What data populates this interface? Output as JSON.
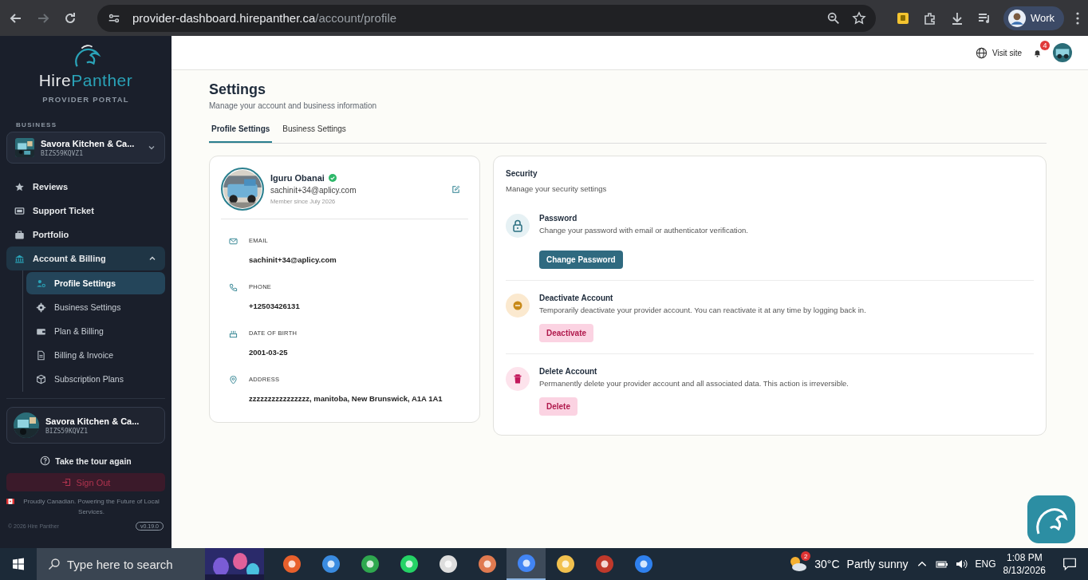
{
  "browser": {
    "url_host": "provider-dashboard.hirepanther.ca",
    "url_path": "/account/profile",
    "profile_label": "Work"
  },
  "sidebar": {
    "brand_first": "Hire",
    "brand_second": "Panther",
    "subtitle": "PROVIDER PORTAL",
    "section_label": "BUSINESS",
    "business": {
      "name": "Savora Kitchen & Ca...",
      "id": "BIZS59KQVZ1"
    },
    "nav": [
      {
        "label": "Reviews",
        "kind": "star",
        "selected": false
      },
      {
        "label": "Support Ticket",
        "kind": "ticket",
        "selected": false
      },
      {
        "label": "Portfolio",
        "kind": "briefcase",
        "selected": false
      },
      {
        "label": "Account & Billing",
        "kind": "bank",
        "selected": false,
        "expanded": true,
        "children": [
          {
            "label": "Profile Settings",
            "kind": "user-gear",
            "selected": true
          },
          {
            "label": "Business Settings",
            "kind": "gear",
            "selected": false
          },
          {
            "label": "Plan & Billing",
            "kind": "wallet",
            "selected": false
          },
          {
            "label": "Billing & Invoice",
            "kind": "document",
            "selected": false
          },
          {
            "label": "Subscription Plans",
            "kind": "box",
            "selected": false
          }
        ]
      }
    ],
    "footer_business": {
      "name": "Savora Kitchen & Ca...",
      "id": "BIZS59KQVZ1"
    },
    "tour": "Take the tour again",
    "sign_out": "Sign Out",
    "tagline": "Proudly Canadian. Powering the Future of Local Services.",
    "copyright": "© 2026 Hire Panther",
    "version": "v0.19.0"
  },
  "header": {
    "visit_site": "Visit site",
    "notification_count": "4"
  },
  "page": {
    "title": "Settings",
    "subtitle": "Manage your account and business information",
    "tabs": [
      {
        "label": "Profile Settings",
        "selected": true
      },
      {
        "label": "Business Settings",
        "selected": false
      }
    ]
  },
  "profile": {
    "name": "Iguru Obanai",
    "verified": true,
    "email": "sachinit+34@aplicy.com",
    "member_since": "Member since July 2026",
    "fields": [
      {
        "kind": "email",
        "label": "EMAIL",
        "value": "sachinit+34@aplicy.com"
      },
      {
        "kind": "phone",
        "label": "PHONE",
        "value": "+12503426131"
      },
      {
        "kind": "cake",
        "label": "DATE OF BIRTH",
        "value": "2001-03-25"
      },
      {
        "kind": "pin",
        "label": "ADDRESS",
        "value": "zzzzzzzzzzzzzzzz, manitoba, New Brunswick, A1A 1A1"
      }
    ]
  },
  "security": {
    "title": "Security",
    "subtitle": "Manage your security settings",
    "items": [
      {
        "kind": "lock",
        "title": "Password",
        "description": "Change your password with email or authenticator verification.",
        "button": "Change Password"
      },
      {
        "kind": "pause",
        "title": "Deactivate Account",
        "description": "Temporarily deactivate your provider account. You can reactivate it at any time by logging back in.",
        "button": "Deactivate"
      },
      {
        "kind": "trash",
        "title": "Delete Account",
        "description": "Permanently delete your provider account and all associated data. This action is irreversible.",
        "button": "Delete"
      }
    ]
  },
  "taskbar": {
    "search_placeholder": "Type here to search",
    "weather_badge": "2",
    "temperature": "30°C",
    "weather": "Partly sunny",
    "language": "ENG",
    "time": "1:08 PM",
    "date": "8/13/2026"
  }
}
